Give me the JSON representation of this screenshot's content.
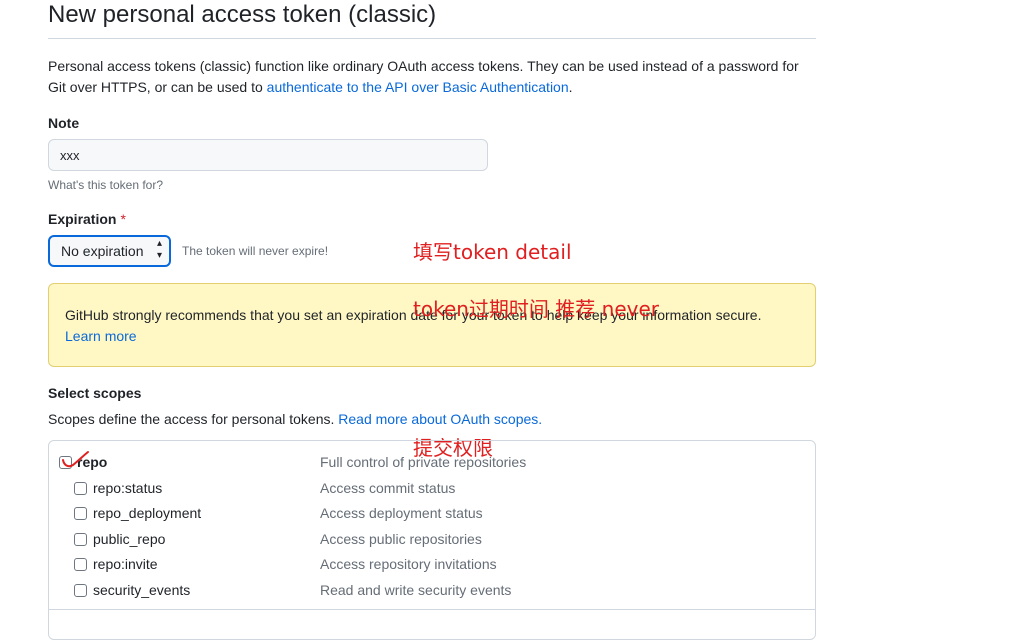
{
  "page": {
    "title": "New personal access token (classic)",
    "intro_text": "Personal access tokens (classic) function like ordinary OAuth access tokens. They can be used instead of a password for Git over HTTPS, or can be used to ",
    "intro_link": "authenticate to the API over Basic Authentication",
    "intro_end": "."
  },
  "note": {
    "label": "Note",
    "value": "xxx",
    "hint": "What's this token for?"
  },
  "expiration": {
    "label": "Expiration",
    "required_mark": "*",
    "selected": "No expiration",
    "hint": "The token will never expire!"
  },
  "warning": {
    "text": "GitHub strongly recommends that you set an expiration date for your token to help keep your information secure.",
    "link": "Learn more"
  },
  "scopes": {
    "heading": "Select scopes",
    "desc": "Scopes define the access for personal tokens. ",
    "link": "Read more about OAuth scopes.",
    "rows": [
      {
        "name": "repo",
        "desc": "Full control of private repositories"
      },
      {
        "name": "repo:status",
        "desc": "Access commit status"
      },
      {
        "name": "repo_deployment",
        "desc": "Access deployment status"
      },
      {
        "name": "public_repo",
        "desc": "Access public repositories"
      },
      {
        "name": "repo:invite",
        "desc": "Access repository invitations"
      },
      {
        "name": "security_events",
        "desc": "Read and write security events"
      }
    ]
  },
  "annotations": {
    "token_detail": "填写token detail",
    "expiration": "token过期时间 推荐 never",
    "scopes": "提交权限"
  },
  "colors": {
    "link": "#0969da",
    "annotation": "#e02020",
    "warning_bg": "#fff8c5"
  }
}
